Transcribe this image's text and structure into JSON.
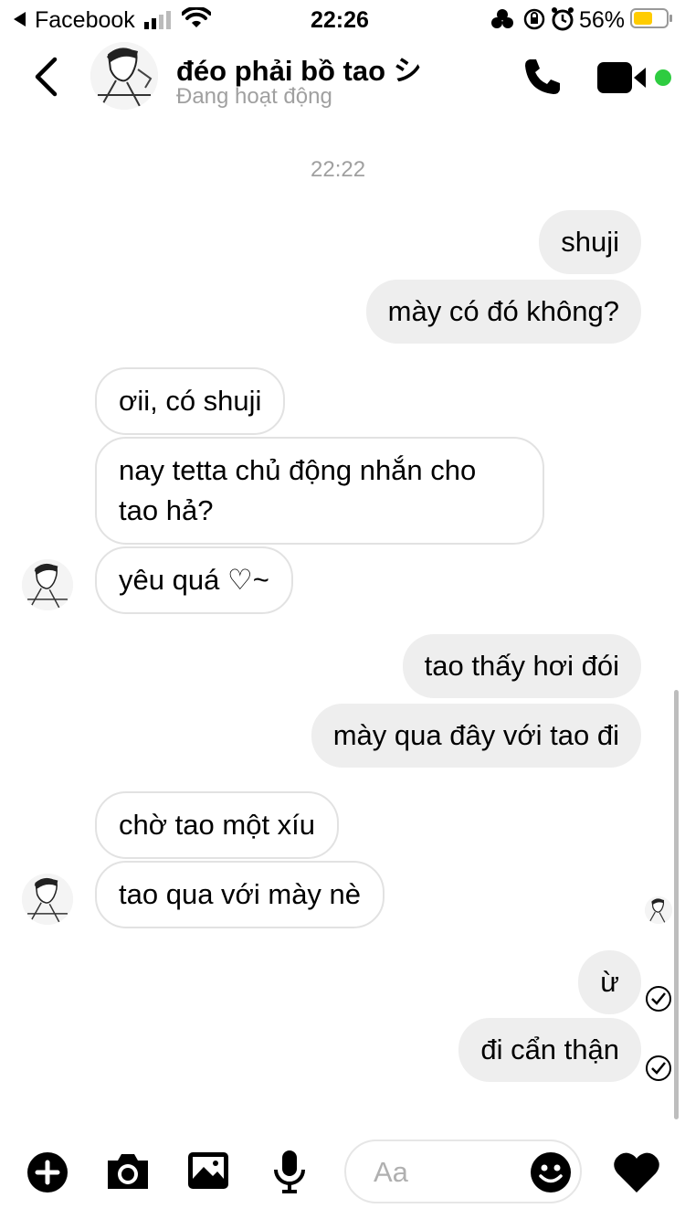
{
  "status_bar": {
    "back_app": "Facebook",
    "time": "22:26",
    "battery": "56%"
  },
  "header": {
    "title": "đéo phải bồ tao シ",
    "subtitle": "Đang hoạt động"
  },
  "timestamp": "22:22",
  "messages": {
    "m1": "shuji",
    "m2": "mày có đó không?",
    "m3": "ơii, có shuji",
    "m4_line1": "nay tetta chủ động nhắn cho",
    "m4_line2": "tao hả?",
    "m5": "yêu quá ♡~",
    "m6": "tao thấy hơi đói",
    "m7": "mày qua đây với tao đi",
    "m8": "chờ tao một xíu",
    "m9": "tao qua với mày nè",
    "m10": "ừ",
    "m11": "đi cẩn thận"
  },
  "composer": {
    "placeholder": "Aa"
  },
  "colors": {
    "outgoing_bubble": "#eeeeee",
    "incoming_border": "#e2e2e2",
    "active_dot": "#2ecc40",
    "battery_fill": "#ffcc00"
  }
}
